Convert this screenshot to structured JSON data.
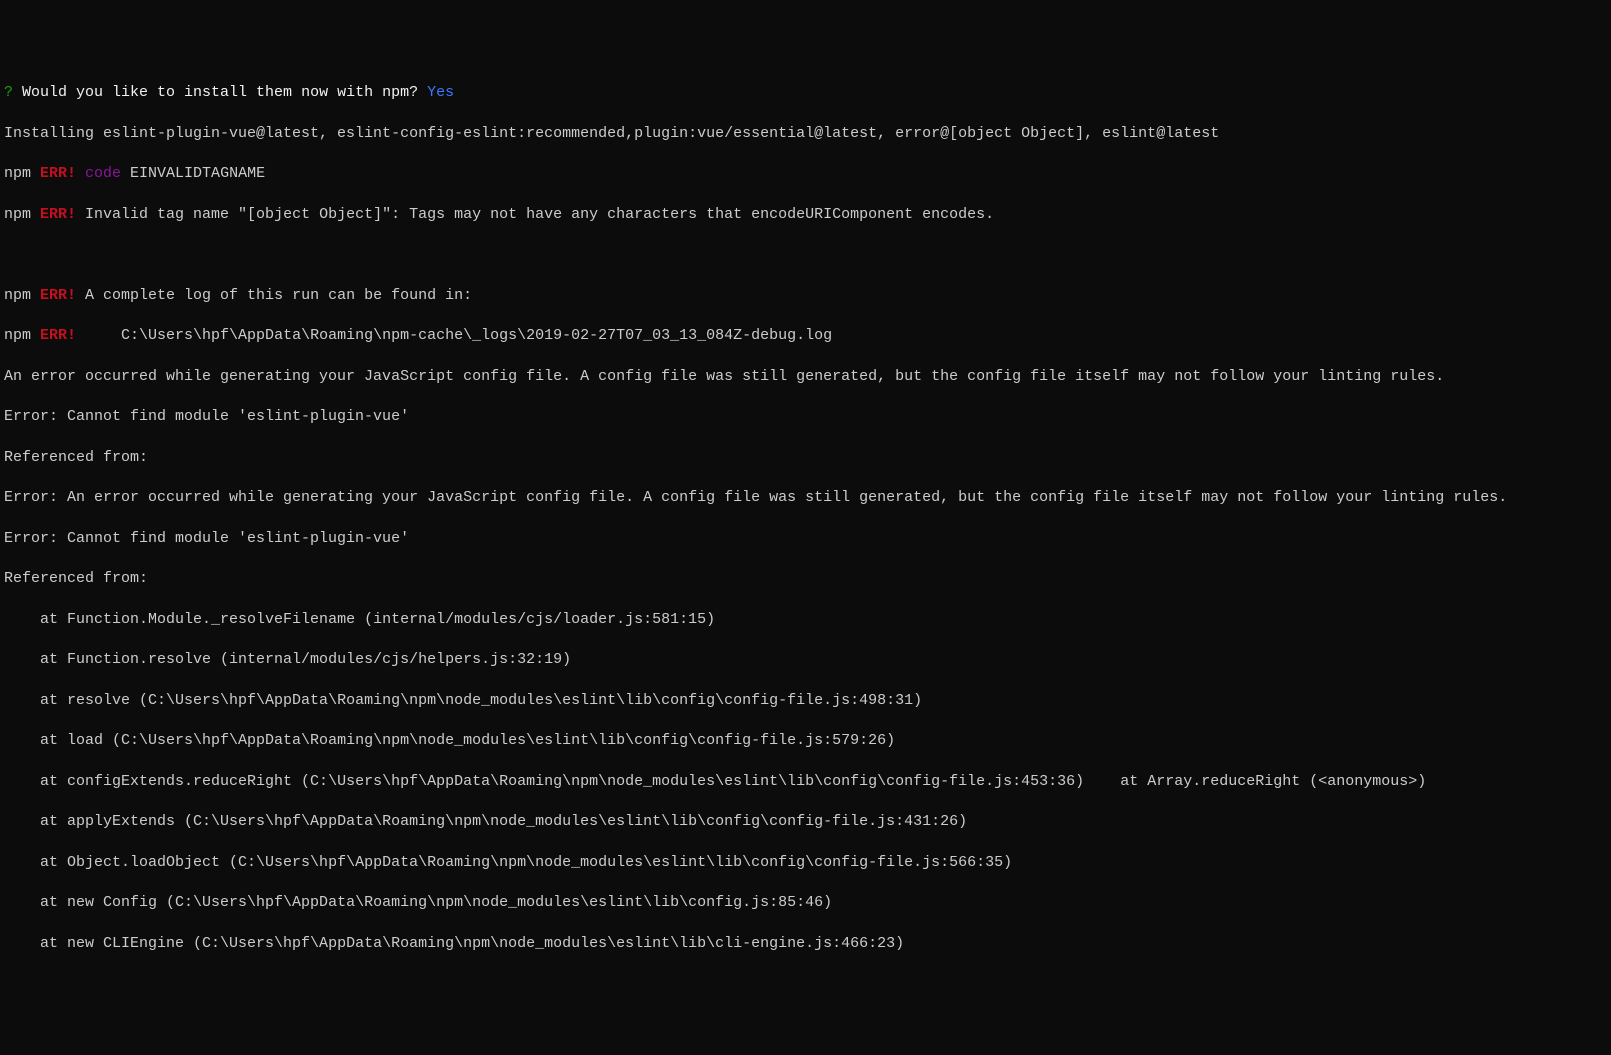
{
  "prompt": {
    "q": "?",
    "question": " Would you like to install them now with npm? ",
    "answer": "Yes"
  },
  "installing": "Installing eslint-plugin-vue@latest, eslint-config-eslint:recommended,plugin:vue/essential@latest, error@[object Object], eslint@latest",
  "npm_prefix": "npm ",
  "err": "ERR!",
  "code_label": " code",
  "code_value": " EINVALIDTAGNAME",
  "err_invalid": " Invalid tag name \"[object Object]\": Tags may not have any characters that encodeURIComponent encodes.",
  "log_msg": " A complete log of this run can be found in:",
  "log_path": "     C:\\Users\\hpf\\AppData\\Roaming\\npm-cache\\_logs\\2019-02-27T07_03_13_084Z-debug.log",
  "err_gen1": "An error occurred while generating your JavaScript config file. A config file was still generated, but the config file itself may not follow your linting rules.",
  "err_cannot1": "Error: Cannot find module 'eslint-plugin-vue'",
  "ref1": "Referenced from:",
  "err_gen2": "Error: An error occurred while generating your JavaScript config file. A config file was still generated, but the config file itself may not follow your linting rules.",
  "err_cannot2": "Error: Cannot find module 'eslint-plugin-vue'",
  "ref2": "Referenced from:",
  "stack": {
    "s1": "    at Function.Module._resolveFilename (internal/modules/cjs/loader.js:581:15)",
    "s2": "    at Function.resolve (internal/modules/cjs/helpers.js:32:19)",
    "s3": "    at resolve (C:\\Users\\hpf\\AppData\\Roaming\\npm\\node_modules\\eslint\\lib\\config\\config-file.js:498:31)",
    "s4": "    at load (C:\\Users\\hpf\\AppData\\Roaming\\npm\\node_modules\\eslint\\lib\\config\\config-file.js:579:26)",
    "s5": "    at configExtends.reduceRight (C:\\Users\\hpf\\AppData\\Roaming\\npm\\node_modules\\eslint\\lib\\config\\config-file.js:453:36)    at Array.reduceRight (<anonymous>)",
    "s6": "    at applyExtends (C:\\Users\\hpf\\AppData\\Roaming\\npm\\node_modules\\eslint\\lib\\config\\config-file.js:431:26)",
    "s7": "    at Object.loadObject (C:\\Users\\hpf\\AppData\\Roaming\\npm\\node_modules\\eslint\\lib\\config\\config-file.js:566:35)",
    "s8": "    at new Config (C:\\Users\\hpf\\AppData\\Roaming\\npm\\node_modules\\eslint\\lib\\config.js:85:46)",
    "s9": "    at new CLIEngine (C:\\Users\\hpf\\AppData\\Roaming\\npm\\node_modules\\eslint\\lib\\cli-engine.js:466:23)"
  }
}
